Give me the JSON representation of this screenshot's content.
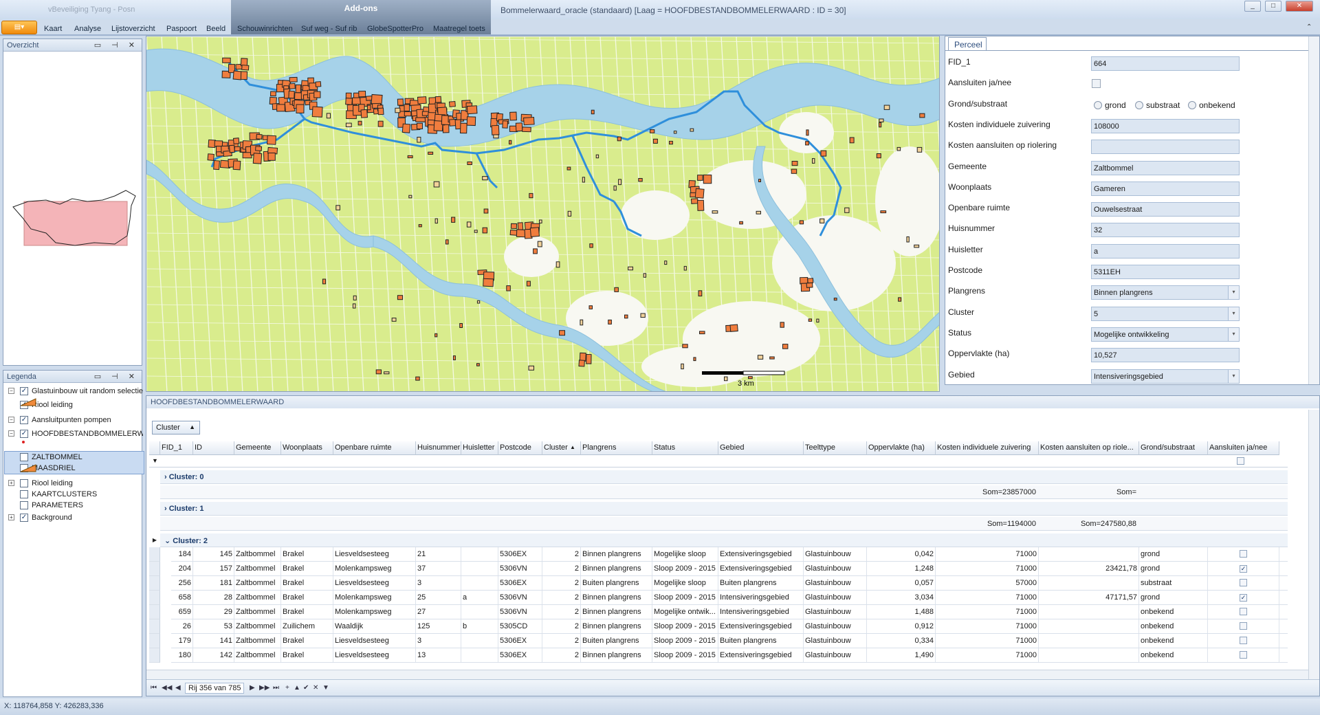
{
  "app": {
    "window_title": "Bommelerwaard_oracle (standaard) [Laag = HOOFDBESTANDBOMMELERWAARD : ID = 30]",
    "faded_title": "vBeveiliging Tyang - Posn",
    "addons_label": "Add-ons",
    "app_button_label": "▤▾"
  },
  "menu": [
    "Kaart",
    "Analyse",
    "Lijstoverzicht",
    "Paspoort",
    "Beeld",
    "Schouwinrichten",
    "Suf weg - Suf rib",
    "GlobeSpotterPro",
    "Maatregel toets"
  ],
  "overzicht": {
    "title": "Overzicht"
  },
  "legend": {
    "title": "Legenda",
    "items": [
      {
        "label": "Glastuinbouw uit random selectie",
        "checked": true,
        "expander": "−"
      },
      {
        "label": "Riool leiding",
        "checked": true,
        "expander": ""
      },
      {
        "label": "Aansluitpunten pompen",
        "checked": true,
        "expander": "−"
      },
      {
        "label": "HOOFDBESTANDBOMMELERWAARD",
        "checked": true,
        "expander": "−"
      },
      {
        "label": "ZALTBOMMEL",
        "checked": false,
        "expander": ""
      },
      {
        "label": "MAASDRIEL",
        "checked": false,
        "expander": ""
      },
      {
        "label": "Riool leiding",
        "checked": false,
        "expander": "+"
      },
      {
        "label": "KAARTCLUSTERS",
        "checked": false,
        "expander": ""
      },
      {
        "label": "PARAMETERS",
        "checked": false,
        "expander": ""
      },
      {
        "label": "Background",
        "checked": true,
        "expander": "+"
      }
    ]
  },
  "map": {
    "scale_label": "3 km",
    "colors": {
      "agri": "#d8ec87",
      "river": "#a9d4ea",
      "pipe": "#2f8fdb",
      "parcel": "#f07d3e"
    }
  },
  "perceel": {
    "tab": "Perceel",
    "fields": [
      {
        "label": "FID_1",
        "value": "664",
        "kind": "text"
      },
      {
        "label": "Aansluiten ja/nee",
        "value": "",
        "kind": "check"
      },
      {
        "label": "Grond/substraat",
        "value": "",
        "kind": "radio"
      },
      {
        "label": "Kosten individuele zuivering",
        "value": "108000",
        "kind": "text"
      },
      {
        "label": "Kosten aansluiten op riolering",
        "value": "",
        "kind": "text"
      },
      {
        "label": "Gemeente",
        "value": "Zaltbommel",
        "kind": "text"
      },
      {
        "label": "Woonplaats",
        "value": "Gameren",
        "kind": "text"
      },
      {
        "label": "Openbare ruimte",
        "value": "Ouwelsestraat",
        "kind": "text"
      },
      {
        "label": "Huisnummer",
        "value": "32",
        "kind": "text"
      },
      {
        "label": "Huisletter",
        "value": "a",
        "kind": "text"
      },
      {
        "label": "Postcode",
        "value": "5311EH",
        "kind": "text"
      },
      {
        "label": "Plangrens",
        "value": "Binnen plangrens",
        "kind": "combo"
      },
      {
        "label": "Cluster",
        "value": "5",
        "kind": "combo"
      },
      {
        "label": "Status",
        "value": "Mogelijke ontwikkeling",
        "kind": "combo"
      },
      {
        "label": "Oppervlakte (ha)",
        "value": "10,527",
        "kind": "text"
      },
      {
        "label": "Gebied",
        "value": "Intensiveringsgebied",
        "kind": "combo"
      }
    ],
    "radio_options": [
      "grond",
      "substraat",
      "onbekend"
    ]
  },
  "grid": {
    "title": "HOOFDBESTANDBOMMELERWAARD",
    "group_button": "Cluster",
    "columns": [
      "FID_1",
      "ID",
      "Gemeente",
      "Woonplaats",
      "Openbare ruimte",
      "Huisnummer",
      "Huisletter",
      "Postcode",
      "Cluster",
      "Plangrens",
      "Status",
      "Gebied",
      "Teelttype",
      "Oppervlakte (ha)",
      "Kosten individuele zuivering",
      "Kosten aansluiten op riole...",
      "Grond/substraat",
      "Aansluiten ja/nee"
    ],
    "groups": [
      {
        "label": "Cluster: 0",
        "sum_a": "Som=23857000",
        "sum_b": "Som="
      },
      {
        "label": "Cluster: 1",
        "sum_a": "Som=1194000",
        "sum_b": "Som=247580,88"
      },
      {
        "label": "Cluster: 2"
      }
    ],
    "rows": [
      [
        "184",
        "145",
        "Zaltbommel",
        "Brakel",
        "Liesveldsesteeg",
        "21",
        "",
        "5306EX",
        "2",
        "Binnen plangrens",
        "Mogelijke sloop",
        "Extensiveringsgebied",
        "Glastuinbouw",
        "0,042",
        "71000",
        "",
        "grond",
        ""
      ],
      [
        "204",
        "157",
        "Zaltbommel",
        "Brakel",
        "Molenkampsweg",
        "37",
        "",
        "5306VN",
        "2",
        "Binnen plangrens",
        "Sloop 2009 - 2015",
        "Extensiveringsgebied",
        "Glastuinbouw",
        "1,248",
        "71000",
        "23421,78",
        "grond",
        "✓"
      ],
      [
        "256",
        "181",
        "Zaltbommel",
        "Brakel",
        "Liesveldsesteeg",
        "3",
        "",
        "5306EX",
        "2",
        "Buiten plangrens",
        "Mogelijke sloop",
        "Buiten plangrens",
        "Glastuinbouw",
        "0,057",
        "57000",
        "",
        "substraat",
        ""
      ],
      [
        "658",
        "28",
        "Zaltbommel",
        "Brakel",
        "Molenkampsweg",
        "25",
        "a",
        "5306VN",
        "2",
        "Binnen plangrens",
        "Sloop 2009 - 2015",
        "Intensiveringsgebied",
        "Glastuinbouw",
        "3,034",
        "71000",
        "47171,57",
        "grond",
        "✓"
      ],
      [
        "659",
        "29",
        "Zaltbommel",
        "Brakel",
        "Molenkampsweg",
        "27",
        "",
        "5306VN",
        "2",
        "Binnen plangrens",
        "Mogelijke ontwik...",
        "Intensiveringsgebied",
        "Glastuinbouw",
        "1,488",
        "71000",
        "",
        "onbekend",
        ""
      ],
      [
        "26",
        "53",
        "Zaltbommel",
        "Zuilichem",
        "Waaldijk",
        "125",
        "b",
        "5305CD",
        "2",
        "Binnen plangrens",
        "Sloop 2009 - 2015",
        "Extensiveringsgebied",
        "Glastuinbouw",
        "0,912",
        "71000",
        "",
        "onbekend",
        ""
      ],
      [
        "179",
        "141",
        "Zaltbommel",
        "Brakel",
        "Liesveldsesteeg",
        "3",
        "",
        "5306EX",
        "2",
        "Buiten plangrens",
        "Sloop 2009 - 2015",
        "Buiten plangrens",
        "Glastuinbouw",
        "0,334",
        "71000",
        "",
        "onbekend",
        ""
      ],
      [
        "180",
        "142",
        "Zaltbommel",
        "Brakel",
        "Liesveldsesteeg",
        "13",
        "",
        "5306EX",
        "2",
        "Binnen plangrens",
        "Sloop 2009 - 2015",
        "Extensiveringsgebied",
        "Glastuinbouw",
        "1,490",
        "71000",
        "",
        "onbekend",
        ""
      ]
    ],
    "record_nav": "Rij 356 van 785"
  },
  "status": {
    "coords": "X: 118764,858 Y: 426283,336"
  }
}
